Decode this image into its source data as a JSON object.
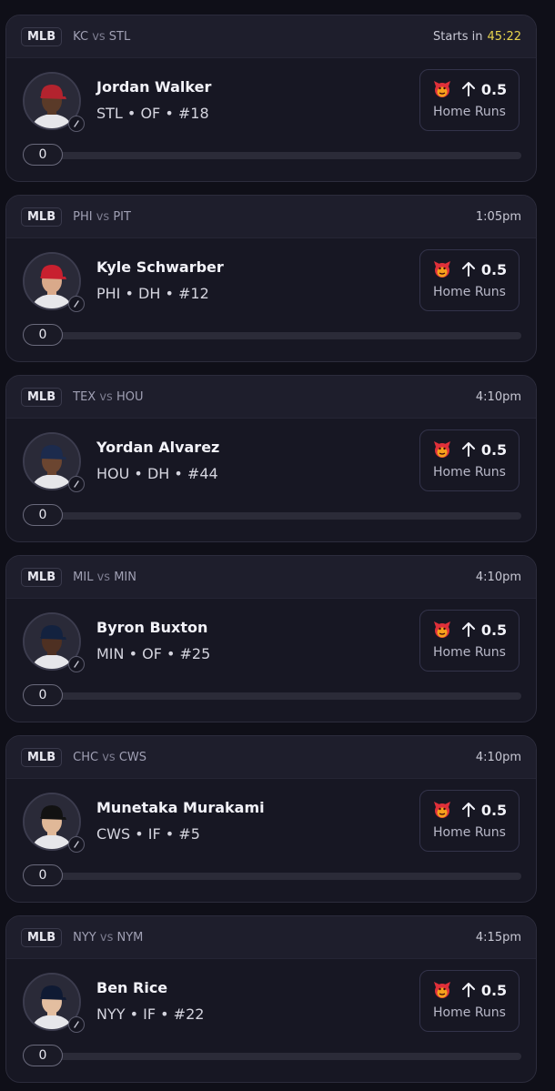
{
  "theme": {
    "accent_countdown": "#e8d44d",
    "background": "#0f0f18",
    "card": "#171723"
  },
  "icons": {
    "prop": "devil-icon",
    "direction": "arrow-up-icon",
    "avatar_badge": "pin-icon"
  },
  "props": [
    {
      "league": "MLB",
      "away": "KC",
      "vs": "vs",
      "home": "STL",
      "time_prefix": "Starts in",
      "time": "45:22",
      "countdown": true,
      "player": "Jordan Walker",
      "team": "STL",
      "position": "OF",
      "number": "#18",
      "line": "0.5",
      "stat": "Home Runs",
      "progress_value": "0",
      "progress_fraction": 0,
      "cap_color": "#b3232e",
      "skin": "#5a3a28"
    },
    {
      "league": "MLB",
      "away": "PHI",
      "vs": "vs",
      "home": "PIT",
      "time_prefix": "",
      "time": "1:05pm",
      "countdown": false,
      "player": "Kyle Schwarber",
      "team": "PHI",
      "position": "DH",
      "number": "#12",
      "line": "0.5",
      "stat": "Home Runs",
      "progress_value": "0",
      "progress_fraction": 0,
      "cap_color": "#c8202f",
      "skin": "#d9a98a"
    },
    {
      "league": "MLB",
      "away": "TEX",
      "vs": "vs",
      "home": "HOU",
      "time_prefix": "",
      "time": "4:10pm",
      "countdown": false,
      "player": "Yordan Alvarez",
      "team": "HOU",
      "position": "DH",
      "number": "#44",
      "line": "0.5",
      "stat": "Home Runs",
      "progress_value": "0",
      "progress_fraction": 0,
      "cap_color": "#1c2b4d",
      "skin": "#6b4530"
    },
    {
      "league": "MLB",
      "away": "MIL",
      "vs": "vs",
      "home": "MIN",
      "time_prefix": "",
      "time": "4:10pm",
      "countdown": false,
      "player": "Byron Buxton",
      "team": "MIN",
      "position": "OF",
      "number": "#25",
      "line": "0.5",
      "stat": "Home Runs",
      "progress_value": "0",
      "progress_fraction": 0,
      "cap_color": "#13223f",
      "skin": "#4e3022"
    },
    {
      "league": "MLB",
      "away": "CHC",
      "vs": "vs",
      "home": "CWS",
      "time_prefix": "",
      "time": "4:10pm",
      "countdown": false,
      "player": "Munetaka Murakami",
      "team": "CWS",
      "position": "IF",
      "number": "#5",
      "line": "0.5",
      "stat": "Home Runs",
      "progress_value": "0",
      "progress_fraction": 0,
      "cap_color": "#121212",
      "skin": "#e0b898"
    },
    {
      "league": "MLB",
      "away": "NYY",
      "vs": "vs",
      "home": "NYM",
      "time_prefix": "",
      "time": "4:15pm",
      "countdown": false,
      "player": "Ben Rice",
      "team": "NYY",
      "position": "IF",
      "number": "#22",
      "line": "0.5",
      "stat": "Home Runs",
      "progress_value": "0",
      "progress_fraction": 0,
      "cap_color": "#0f1a33",
      "skin": "#e3bea0"
    }
  ]
}
